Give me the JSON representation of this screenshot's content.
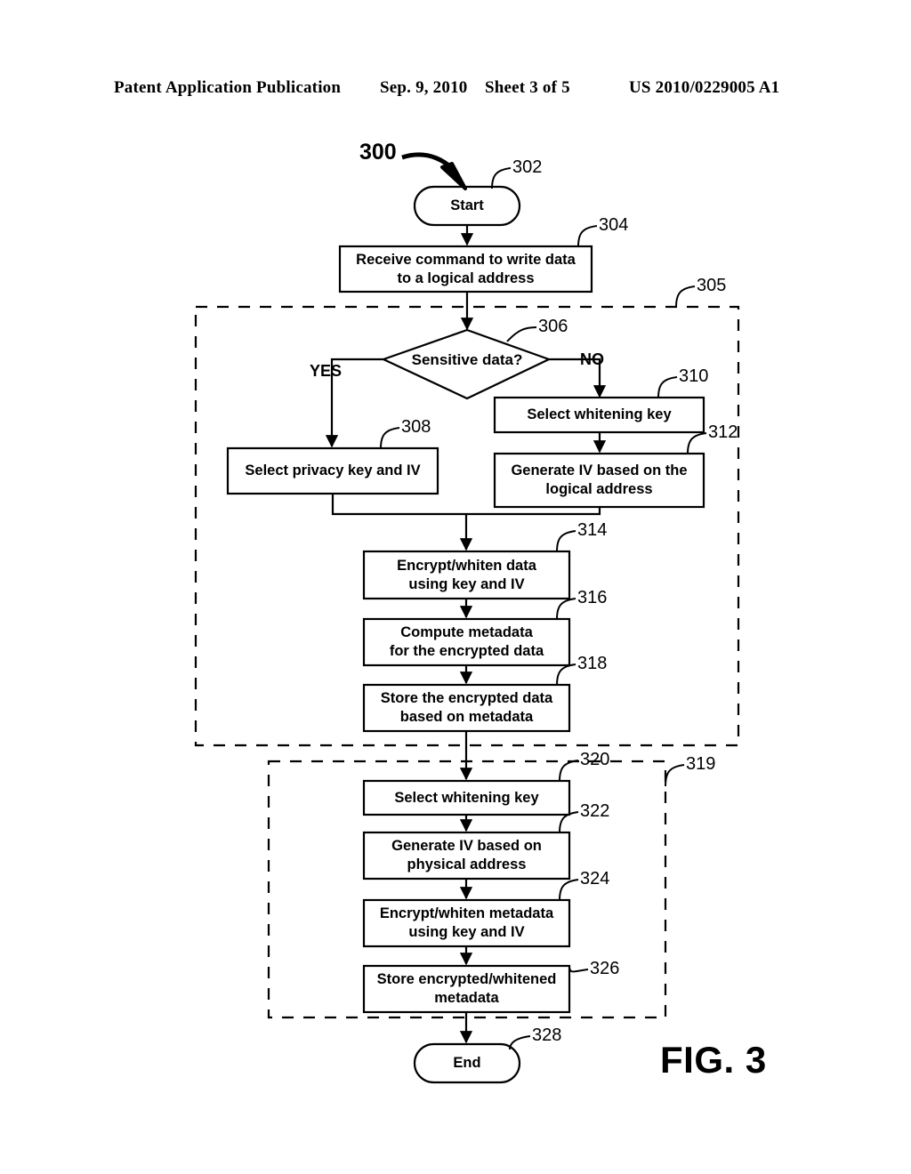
{
  "header": {
    "publication": "Patent Application Publication",
    "date": "Sep. 9, 2010",
    "sheet": "Sheet 3 of 5",
    "patent_number": "US 2010/0229005 A1"
  },
  "figure": {
    "label": "FIG. 3",
    "flow_number": "300"
  },
  "flowchart": {
    "start": {
      "text": "Start",
      "ref": "302"
    },
    "end": {
      "text": "End",
      "ref": "328"
    },
    "decision": {
      "text": "Sensitive data?",
      "ref": "306"
    },
    "branch_yes": "YES",
    "branch_no": "NO",
    "groups": [
      {
        "ref": "305"
      },
      {
        "ref": "319"
      }
    ],
    "steps": [
      {
        "ref": "304",
        "text": "Receive command to write data to a logical address"
      },
      {
        "ref": "308",
        "text": "Select privacy key and IV"
      },
      {
        "ref": "310",
        "text": "Select whitening key"
      },
      {
        "ref": "312",
        "text": "Generate IV based on the logical address"
      },
      {
        "ref": "314",
        "text": "Encrypt/whiten data using key and IV"
      },
      {
        "ref": "316",
        "text": "Compute metadata for the encrypted data"
      },
      {
        "ref": "318",
        "text": "Store the encrypted data based on metadata"
      },
      {
        "ref": "320",
        "text": "Select whitening key"
      },
      {
        "ref": "322",
        "text": "Generate IV based on physical address"
      },
      {
        "ref": "324",
        "text": "Encrypt/whiten metadata using key and IV"
      },
      {
        "ref": "326",
        "text": "Store encrypted/whitened metadata"
      }
    ],
    "step_lines": {
      "304": [
        "Receive command to write data",
        "to a logical address"
      ],
      "308": [
        "Select privacy key and IV"
      ],
      "310": [
        "Select whitening key"
      ],
      "312": [
        "Generate IV based on the",
        "logical address"
      ],
      "314": [
        "Encrypt/whiten data",
        "using key and IV"
      ],
      "316": [
        "Compute metadata",
        "for the encrypted data"
      ],
      "318": [
        "Store the encrypted data",
        "based on metadata"
      ],
      "320": [
        "Select whitening key"
      ],
      "322": [
        "Generate IV based on",
        "physical address"
      ],
      "324": [
        "Encrypt/whiten metadata",
        "using key and IV"
      ],
      "326": [
        "Store encrypted/whitened",
        "metadata"
      ]
    }
  },
  "colors": {
    "ink": "#000000",
    "paper": "#ffffff"
  }
}
